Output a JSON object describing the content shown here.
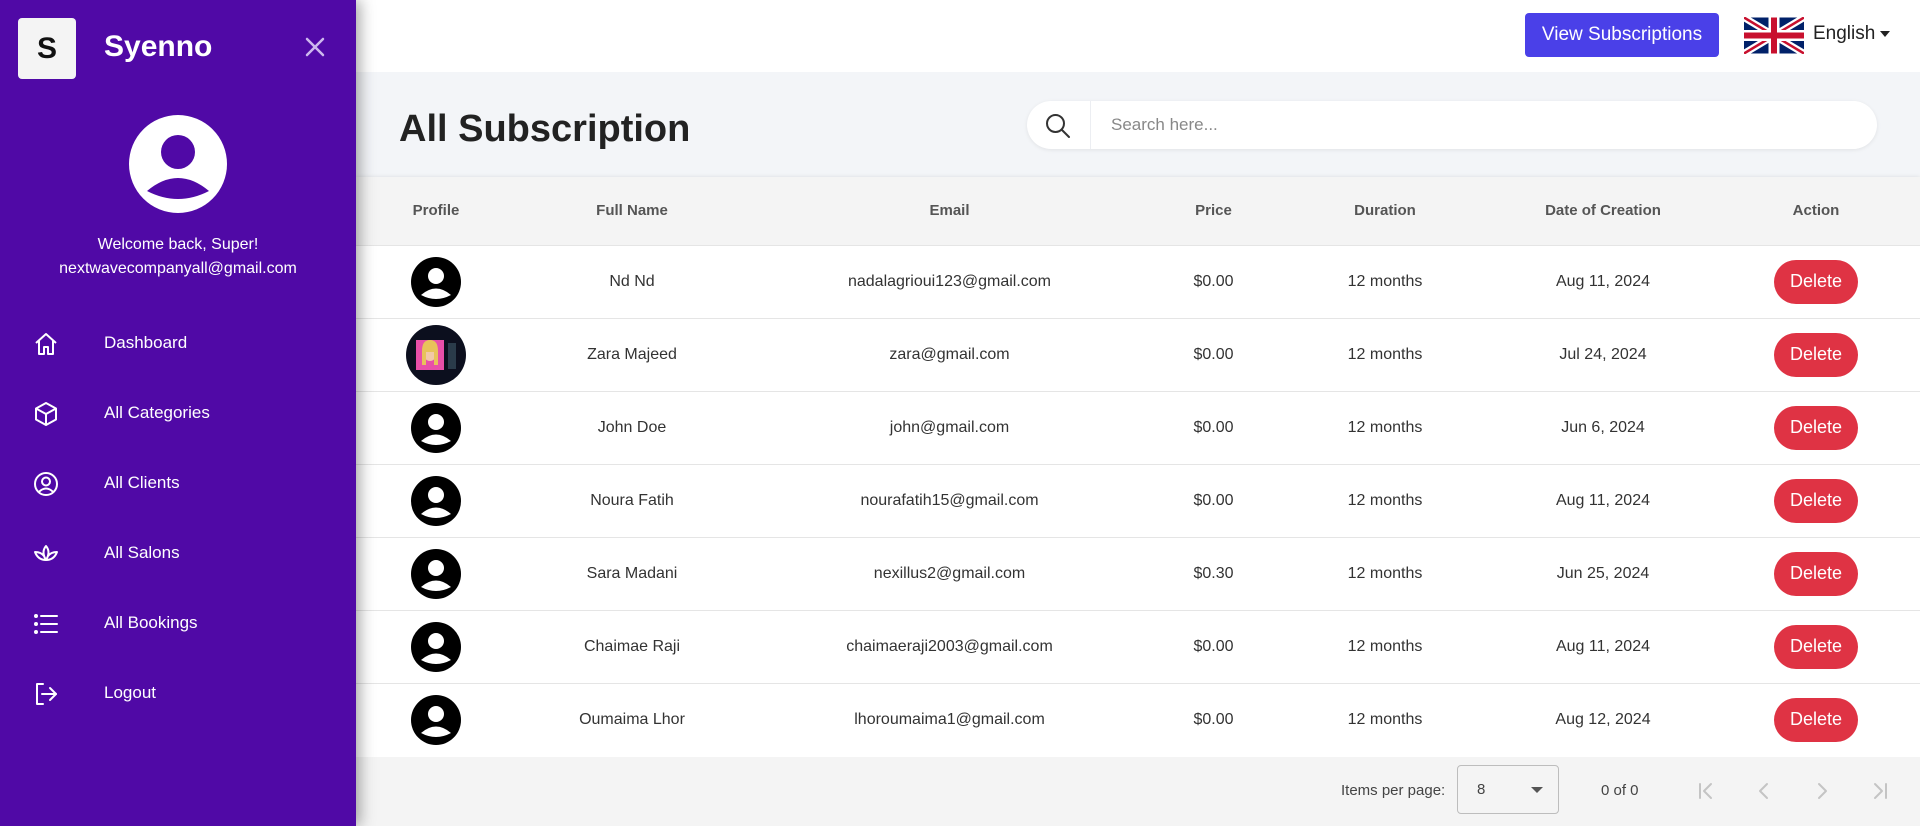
{
  "sidebar": {
    "logo_letter": "S",
    "brand": "Syenno",
    "welcome": "Welcome back, Super!",
    "email": "nextwavecompanyall@gmail.com",
    "items": [
      {
        "label": "Dashboard",
        "icon": "home-icon"
      },
      {
        "label": "All Categories",
        "icon": "box-icon"
      },
      {
        "label": "All Clients",
        "icon": "user-circle-icon"
      },
      {
        "label": "All Salons",
        "icon": "lotus-icon"
      },
      {
        "label": "All Bookings",
        "icon": "list-icon"
      },
      {
        "label": "Logout",
        "icon": "logout-icon"
      }
    ]
  },
  "topbar": {
    "view_subscriptions": "View Subscriptions",
    "language": "English"
  },
  "page": {
    "title": "All Subscription"
  },
  "search": {
    "placeholder": "Search here...",
    "value": ""
  },
  "table": {
    "headers": [
      "Profile",
      "Full Name",
      "Email",
      "Price",
      "Duration",
      "Date of Creation",
      "Action"
    ],
    "rows": [
      {
        "name": "Nd Nd",
        "email": "nadalagrioui123@gmail.com",
        "price": "$0.00",
        "duration": "12 months",
        "date": "Aug 11, 2024",
        "action": "Delete",
        "photo": false
      },
      {
        "name": "Zara Majeed",
        "email": "zara@gmail.com",
        "price": "$0.00",
        "duration": "12 months",
        "date": "Jul 24, 2024",
        "action": "Delete",
        "photo": true
      },
      {
        "name": "John Doe",
        "email": "john@gmail.com",
        "price": "$0.00",
        "duration": "12 months",
        "date": "Jun 6, 2024",
        "action": "Delete",
        "photo": false
      },
      {
        "name": "Noura Fatih",
        "email": "nourafatih15@gmail.com",
        "price": "$0.00",
        "duration": "12 months",
        "date": "Aug 11, 2024",
        "action": "Delete",
        "photo": false
      },
      {
        "name": "Sara Madani",
        "email": "nexillus2@gmail.com",
        "price": "$0.30",
        "duration": "12 months",
        "date": "Jun 25, 2024",
        "action": "Delete",
        "photo": false
      },
      {
        "name": "Chaimae Raji",
        "email": "chaimaeraji2003@gmail.com",
        "price": "$0.00",
        "duration": "12 months",
        "date": "Aug 11, 2024",
        "action": "Delete",
        "photo": false
      },
      {
        "name": "Oumaima Lhor",
        "email": "lhoroumaima1@gmail.com",
        "price": "$0.00",
        "duration": "12 months",
        "date": "Aug 12, 2024",
        "action": "Delete",
        "photo": false
      }
    ]
  },
  "paginator": {
    "items_per_page_label": "Items per page:",
    "items_per_page": "8",
    "range": "0 of 0"
  },
  "colors": {
    "sidebar_bg": "#5009a6",
    "primary_button": "#4a40e8",
    "delete_button": "#df3344"
  }
}
